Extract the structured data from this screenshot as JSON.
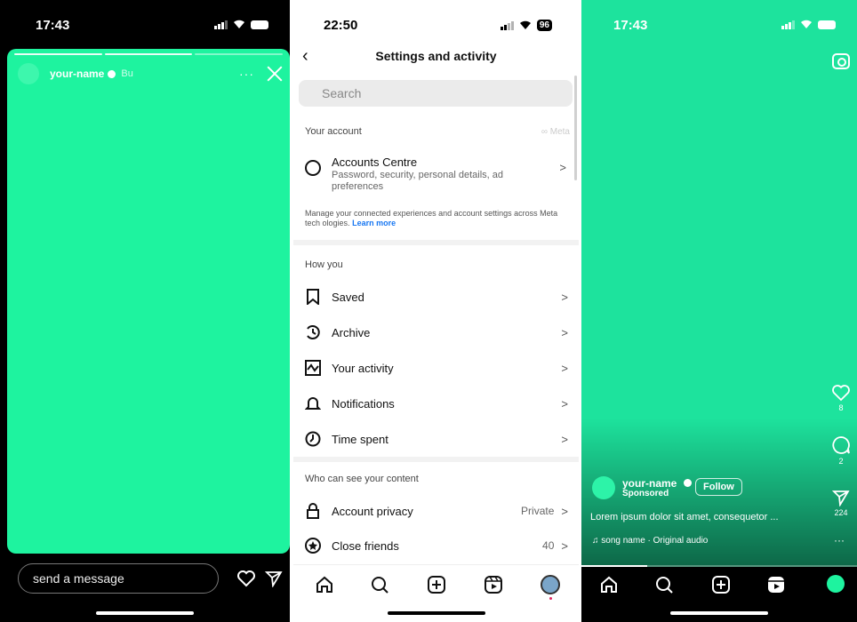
{
  "story_screen": {
    "time": "17:43",
    "username": "your-name",
    "subtitle": "Bu",
    "more_label": "···",
    "message_placeholder": "send a message",
    "story_color": "#1ef39f"
  },
  "settings_screen": {
    "time": "22:50",
    "battery": "96",
    "title": "Settings and activity",
    "search_placeholder": "Search",
    "your_account": {
      "heading": "Your account",
      "meta_label": "∞ Meta",
      "accounts_centre_title": "Accounts Centre",
      "accounts_centre_sub": "Password, security, personal details, ad preferences",
      "manage_text": "Manage your connected experiences and account settings across Meta tech",
      "manage_text_2": "ologies.",
      "learn_more": "Learn more"
    },
    "how_you_use": {
      "heading": "How you",
      "items": [
        {
          "label": "Saved",
          "icon": "bookmark-icon"
        },
        {
          "label": "Archive",
          "icon": "archive-icon"
        },
        {
          "label": "Your activity",
          "icon": "activity-icon"
        },
        {
          "label": "Notifications",
          "icon": "bell-icon"
        },
        {
          "label": "Time spent",
          "icon": "clock-icon"
        }
      ]
    },
    "who_can_see": {
      "heading": "Who can see your content",
      "items": [
        {
          "label": "Account privacy",
          "value": "Private",
          "icon": "lock-icon"
        },
        {
          "label": "Close friends",
          "value": "40",
          "icon": "star-icon"
        }
      ]
    },
    "chevron": ">"
  },
  "reel_screen": {
    "time": "17:43",
    "likes": "8",
    "comments": "2",
    "shares": "224",
    "username": "your-name",
    "sponsored": "Sponsored",
    "follow_label": "Follow",
    "caption": "Lorem ipsum dolor sit amet, consequetor ...",
    "audio": "song name · Original audio",
    "more_label": "···",
    "progress": 0.24
  }
}
